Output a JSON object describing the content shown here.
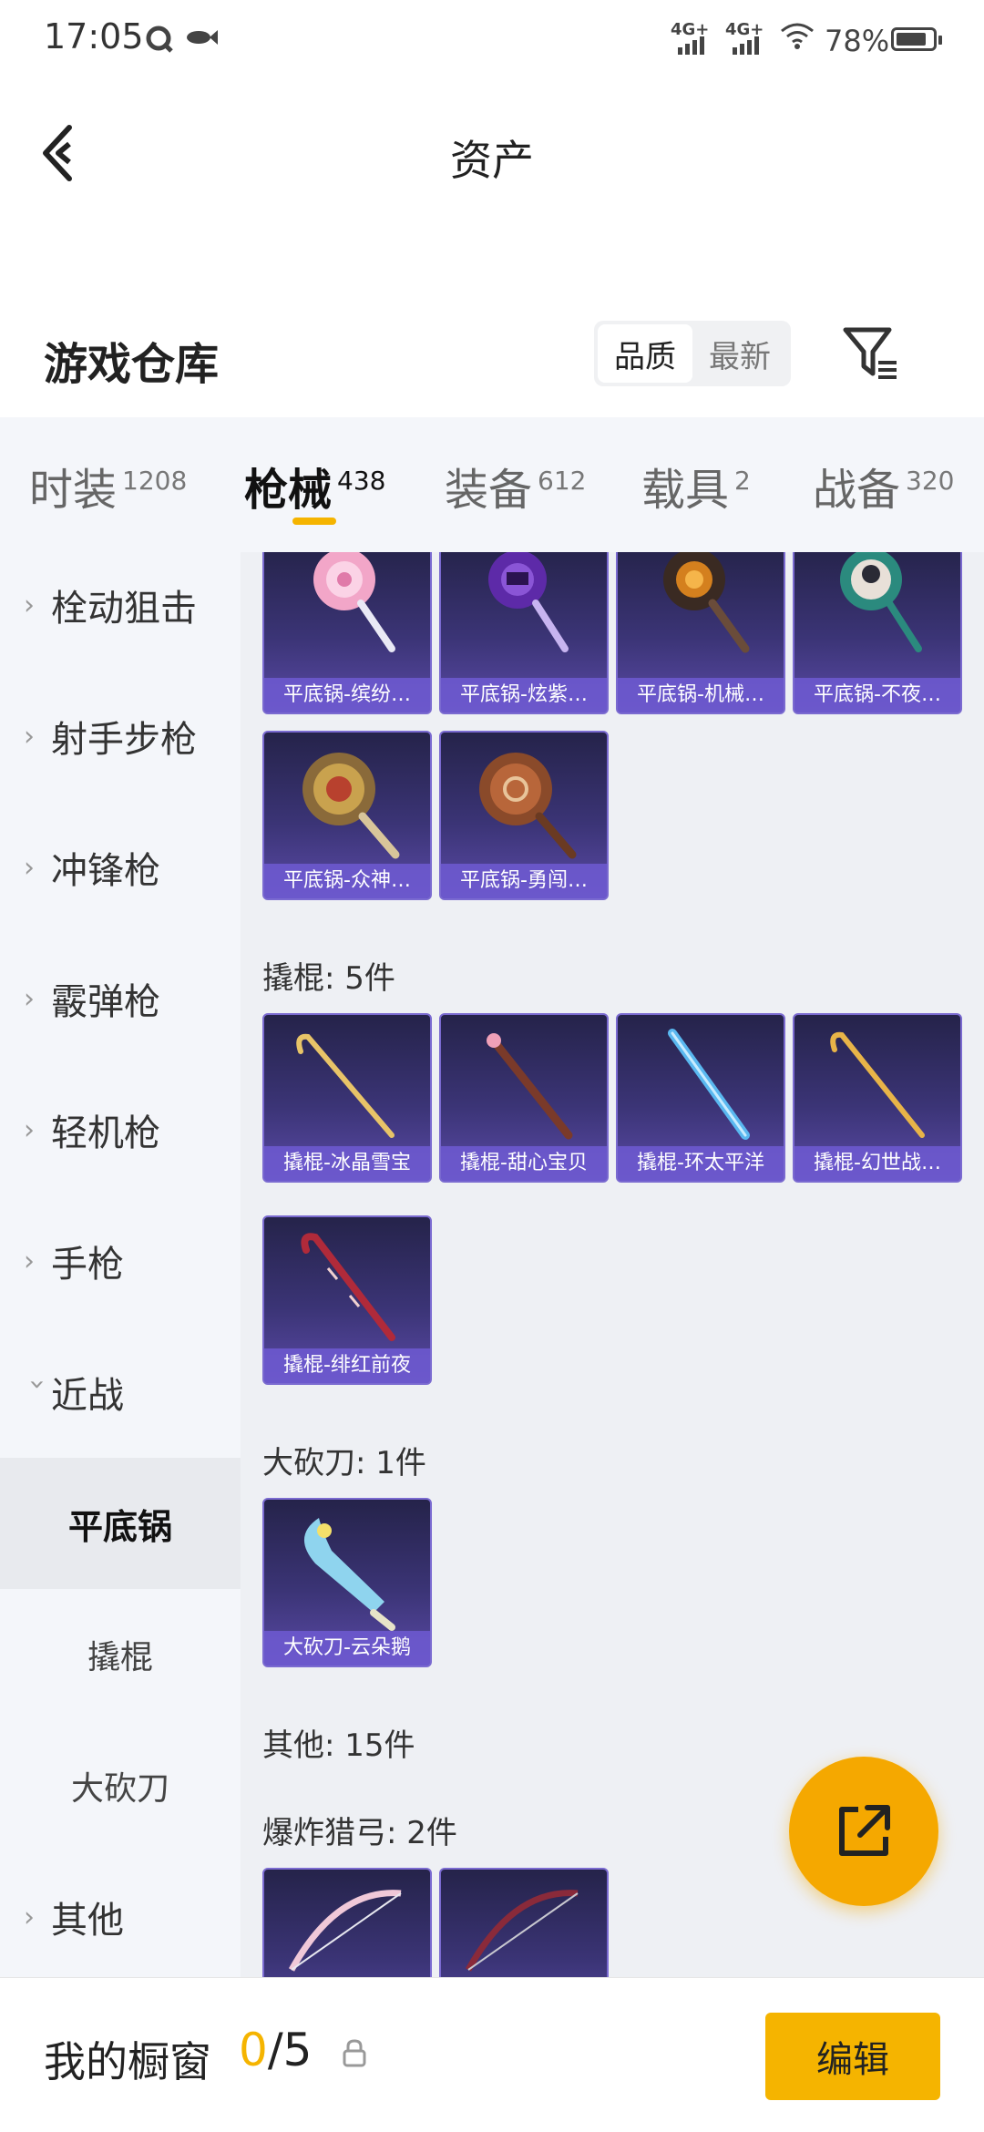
{
  "status_bar": {
    "time": "17:05",
    "network1": "4G+",
    "network2": "4G+",
    "battery": "78%"
  },
  "header": {
    "title": "资产"
  },
  "section": {
    "title": "游戏仓库",
    "sort_options": [
      "品质",
      "最新"
    ],
    "sort_active": 0
  },
  "tabs": [
    {
      "label": "时装",
      "count": "1208"
    },
    {
      "label": "枪械",
      "count": "438"
    },
    {
      "label": "装备",
      "count": "612"
    },
    {
      "label": "载具",
      "count": "2"
    },
    {
      "label": "战备",
      "count": "320"
    }
  ],
  "sidebar": {
    "items": [
      "栓动狙击",
      "射手步枪",
      "冲锋枪",
      "霰弹枪",
      "轻机枪",
      "手枪",
      "近战"
    ],
    "sub_items": [
      "平底锅",
      "撬棍",
      "大砍刀"
    ],
    "other": "其他"
  },
  "content": {
    "pan_items": [
      "平底锅-缤纷…",
      "平底锅-炫紫…",
      "平底锅-机械…",
      "平底锅-不夜…",
      "平底锅-众神…",
      "平底锅-勇闯…"
    ],
    "crowbar_header": "撬棍: 5件",
    "crowbar_items": [
      "撬棍-冰晶雪宝",
      "撬棍-甜心宝贝",
      "撬棍-环太平洋",
      "撬棍-幻世战…",
      "撬棍-绯红前夜"
    ],
    "machete_header": "大砍刀: 1件",
    "machete_items": [
      "大砍刀-云朵鹅"
    ],
    "other_header": "其他: 15件",
    "crossbow_header": "爆炸猎弓: 2件"
  },
  "bottom_bar": {
    "title": "我的橱窗",
    "current": "0",
    "total": "/5",
    "edit_label": "编辑"
  },
  "colors": {
    "accent": "#f5b400",
    "card_bg": "#3b3476",
    "card_label": "#6e5ad2"
  }
}
